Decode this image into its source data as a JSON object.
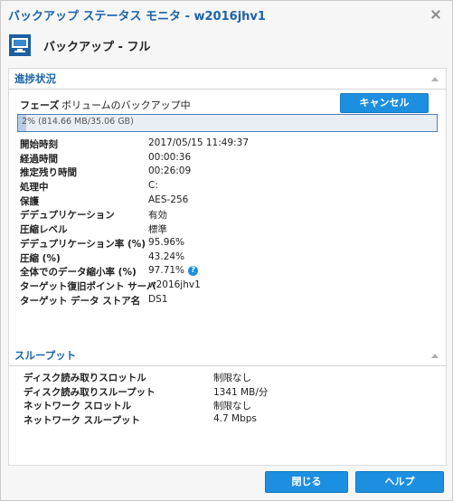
{
  "window": {
    "title": "バックアップ ステータス モニタ - w2016jhv1"
  },
  "header": {
    "icon": "monitor-icon",
    "text": "バックアップ - フル"
  },
  "progress_section": {
    "title": "進捗状況",
    "phase_label": "フェーズ",
    "phase_value": "ボリュームのバックアップ中",
    "cancel_label": "キャンセル",
    "progress_text": "2% (814.66 MB/35.06 GB)",
    "progress_fraction": 0.02,
    "details": [
      {
        "label": "開始時刻",
        "value": "2017/05/15 11:49:37"
      },
      {
        "label": "経過時間",
        "value": "00:00:36"
      },
      {
        "label": "推定残り時間",
        "value": "00:26:09"
      },
      {
        "label": "処理中",
        "value": "C:"
      },
      {
        "label": "保護",
        "value": "AES-256"
      },
      {
        "label": "デデュプリケーション",
        "value": "有効"
      },
      {
        "label": "圧縮レベル",
        "value": "標準"
      },
      {
        "label": "デデュプリケーション率 (%)",
        "value": "95.96%"
      },
      {
        "label": "圧縮 (%)",
        "value": "43.24%"
      },
      {
        "label": "全体でのデータ縮小率 (%)",
        "value": "97.71%"
      },
      {
        "label": "ターゲット復旧ポイント サーバ",
        "value": "w2016jhv1"
      },
      {
        "label": "ターゲット データ ストア名",
        "value": "DS1"
      }
    ]
  },
  "throughput_section": {
    "title": "スループット",
    "details": [
      {
        "label": "ディスク読み取りスロットル",
        "value": "制限なし"
      },
      {
        "label": "ディスク読み取りスループット",
        "value": "1341 MB/分"
      },
      {
        "label": "ネットワーク スロットル",
        "value": "制限なし"
      },
      {
        "label": "ネットワーク スループット",
        "value": "4.7 Mbps"
      }
    ]
  },
  "footer": {
    "close_label": "閉じる",
    "help_label": "ヘルプ"
  },
  "colors": {
    "accent": "#1d8fe0",
    "title": "#1b63a9"
  }
}
